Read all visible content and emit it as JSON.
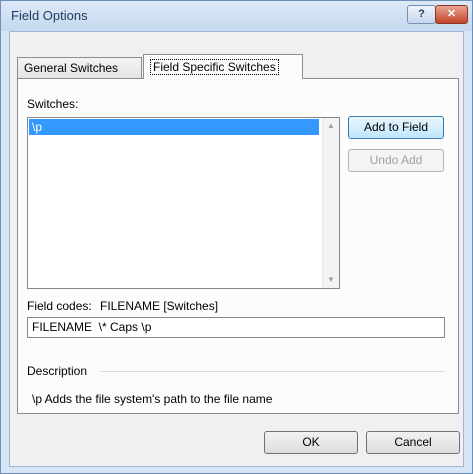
{
  "window": {
    "title": "Field Options",
    "help_label": "?",
    "close_label": "✕"
  },
  "tabs": [
    {
      "label": "General Switches",
      "selected": false
    },
    {
      "label": "Field Specific Switches",
      "selected": true
    }
  ],
  "switches": {
    "label": "Switches:",
    "items": [
      "\\p"
    ],
    "selected_index": 0
  },
  "buttons": {
    "add_to_field": "Add to Field",
    "undo_add": "Undo Add",
    "ok": "OK",
    "cancel": "Cancel"
  },
  "field_codes": {
    "label": "Field codes:",
    "syntax": "FILENAME [Switches]",
    "value": "FILENAME  \\* Caps \\p"
  },
  "description": {
    "heading": "Description",
    "text": "\\p Adds the file system's path to the file name"
  },
  "icons": {
    "scroll_up": "scroll-up-arrow-icon",
    "scroll_down": "scroll-down-arrow-icon"
  }
}
